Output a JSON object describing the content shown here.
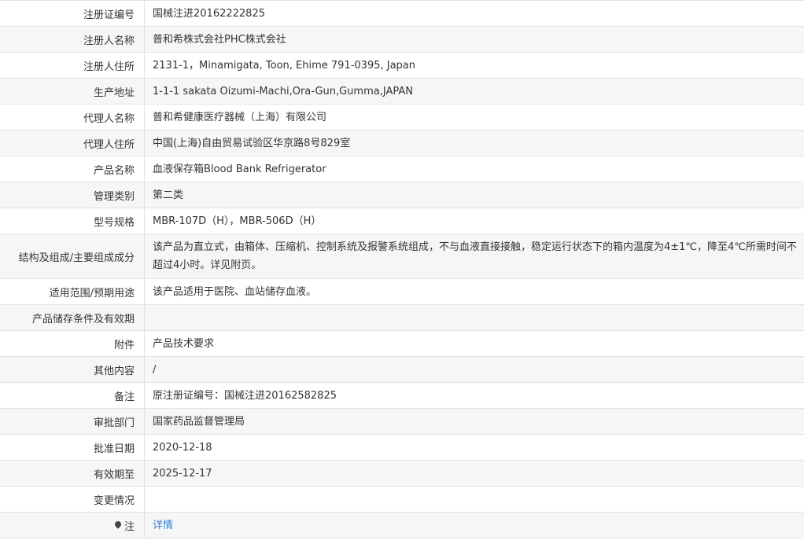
{
  "rows": [
    {
      "label": "注册证编号",
      "value": "国械注进20162222825"
    },
    {
      "label": "注册人名称",
      "value": "普和希株式会社PHC株式会社"
    },
    {
      "label": "注册人住所",
      "value": "2131-1，Minamigata, Toon, Ehime 791-0395, Japan"
    },
    {
      "label": "生产地址",
      "value": "1-1-1 sakata Oizumi-Machi,Ora-Gun,Gumma,JAPAN"
    },
    {
      "label": "代理人名称",
      "value": "普和希健康医疗器械（上海）有限公司"
    },
    {
      "label": "代理人住所",
      "value": "中国(上海)自由贸易试验区华京路8号829室"
    },
    {
      "label": "产品名称",
      "value": "血液保存箱Blood Bank Refrigerator"
    },
    {
      "label": "管理类别",
      "value": "第二类"
    },
    {
      "label": "型号规格",
      "value": "MBR-107D（H），MBR-506D（H）"
    },
    {
      "label": "结构及组成/主要组成成分",
      "value": "该产品为直立式，由箱体、压缩机、控制系统及报警系统组成，不与血液直接接触，稳定运行状态下的箱内温度为4±1℃，降至4℃所需时间不超过4小时。详见附页。"
    },
    {
      "label": "适用范围/预期用途",
      "value": "该产品适用于医院、血站储存血液。"
    },
    {
      "label": "产品储存条件及有效期",
      "value": ""
    },
    {
      "label": "附件",
      "value": "产品技术要求"
    },
    {
      "label": "其他内容",
      "value": "/"
    },
    {
      "label": "备注",
      "value": "原注册证编号：国械注进20162582825"
    },
    {
      "label": "审批部门",
      "value": "国家药品监督管理局"
    },
    {
      "label": "批准日期",
      "value": "2020-12-18"
    },
    {
      "label": "有效期至",
      "value": "2025-12-17"
    },
    {
      "label": "变更情况",
      "value": ""
    }
  ],
  "note_row": {
    "label": "注",
    "icon": "pin-icon",
    "link_text": "详情"
  },
  "colors": {
    "link": "#2e83d8",
    "alt_row": "#f6f6f6",
    "border": "#e2e2e2"
  }
}
